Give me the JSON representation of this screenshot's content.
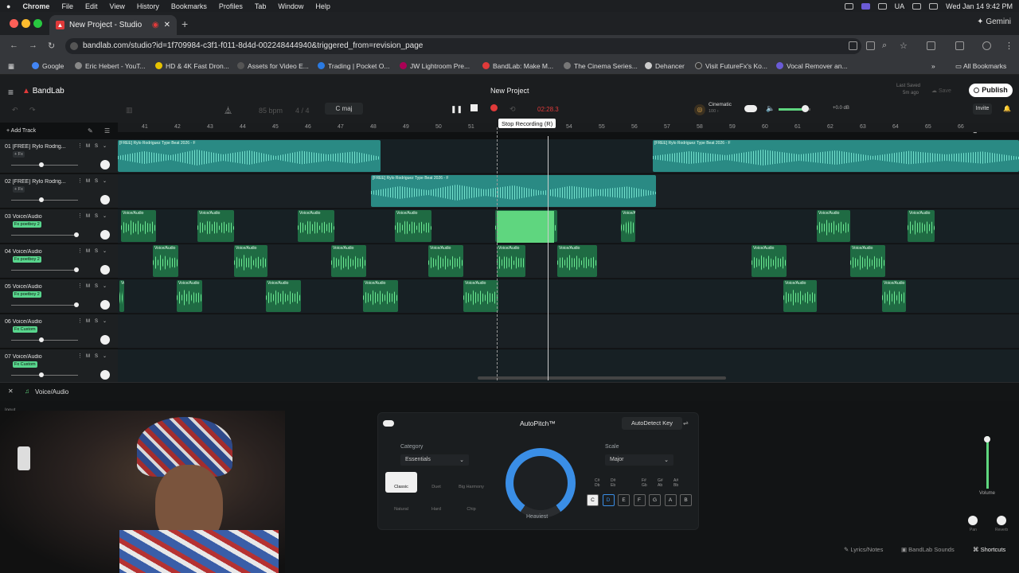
{
  "macbar": {
    "apple": "",
    "app": "Chrome",
    "menus": [
      "File",
      "Edit",
      "View",
      "History",
      "Bookmarks",
      "Profiles",
      "Tab",
      "Window",
      "Help"
    ],
    "lang": "UA",
    "clock": "Wed Jan 14  9:42 PM"
  },
  "browser": {
    "tab_title": "New Project - Studio",
    "gemini": "Gemini",
    "url": "bandlab.com/studio?id=1f709984-c3f1-f011-8d4d-002248444940&triggered_from=revision_page",
    "bookmarks": [
      "Google",
      "Eric Hebert - YouT...",
      "HD & 4K Fast Dron...",
      "Assets for Video E...",
      "Trading | Pocket O...",
      "JW Lightroom Pre...",
      "BandLab: Make M...",
      "The Cinema Series...",
      "Dehancer",
      "Visit FutureFx's Ko...",
      "Vocal Remover an..."
    ],
    "all_bookmarks": "All Bookmarks"
  },
  "app": {
    "logo": "BandLab",
    "project_title": "New Project",
    "last_saved": "Last Saved",
    "saved_ago": "5m ago",
    "save": "Save",
    "publish": "Publish",
    "invite": "Invite",
    "bpm": "85",
    "bpm_unit": "bpm",
    "time_sig": "4 / 4",
    "key": "C maj",
    "timer": "02:28.3",
    "tooltip": "Stop Recording (R)",
    "preset": "Cinematic",
    "preset_sub": "100 ›",
    "master_db": "+0.0 dB",
    "add_track": "Add Track"
  },
  "ruler": [
    "41",
    "42",
    "43",
    "44",
    "45",
    "46",
    "47",
    "48",
    "49",
    "50",
    "51",
    "52",
    "53",
    "54",
    "55",
    "56",
    "57",
    "58",
    "59",
    "60",
    "61",
    "62",
    "63",
    "64",
    "65",
    "66"
  ],
  "tracks": [
    {
      "name": "01  [FREE] Rylo Rodrig...",
      "fx": "+ Fx",
      "fx_on": false,
      "vol": 0.45
    },
    {
      "name": "02  [FREE] Rylo Rodrig...",
      "fx": "+ Fx",
      "fx_on": false,
      "vol": 0.45
    },
    {
      "name": "03  Voice/Audio",
      "fx": "Fx  poetboy 2",
      "fx_on": true,
      "vol": 0.98
    },
    {
      "name": "04  Voice/Audio",
      "fx": "Fx  poetboy 2",
      "fx_on": true,
      "vol": 0.98
    },
    {
      "name": "05  Voice/Audio",
      "fx": "Fx  poetboy 2",
      "fx_on": true,
      "vol": 0.98
    },
    {
      "name": "06  Voice/Audio",
      "fx": "Fx  Custom",
      "fx_on": true,
      "vol": 0.45
    },
    {
      "name": "07  Voice/Audio",
      "fx": "Fx  Custom",
      "fx_on": true,
      "vol": 0.45
    }
  ],
  "clip_labels": {
    "beat": "[FREE] Rylo Rodriguez Type Beat 2026 - F",
    "vocal": "Voice/Audio"
  },
  "editor": {
    "track": "Voice/Audio",
    "input": "Input",
    "autopitch": "AutoPitch™",
    "autodetect": "AutoDetect Key",
    "category_label": "Category",
    "category": "Essentials",
    "scale_label": "Scale",
    "scale": "Major",
    "knob_label": "Heaviest",
    "categories": [
      "Classic",
      "Duet",
      "Big Harmony",
      "Natural",
      "Hard",
      "Chip"
    ],
    "keys": [
      "C",
      "D",
      "E",
      "F",
      "G",
      "A",
      "B"
    ],
    "sharps": [
      "C#\nDb",
      "D#\nEb",
      "F#\nGb",
      "G#\nAb",
      "A#\nBb"
    ],
    "volume": "Volume",
    "pan": "Pan",
    "reverb": "Reverb"
  },
  "footer": {
    "lyrics": "Lyrics/Notes",
    "sounds": "BandLab Sounds",
    "shortcuts": "Shortcuts"
  },
  "colors": {
    "accent": "#5fd67f",
    "beat_clip": "#2a8a84",
    "vocal_clip": "#1f6b43",
    "record": "#e03a3a"
  }
}
